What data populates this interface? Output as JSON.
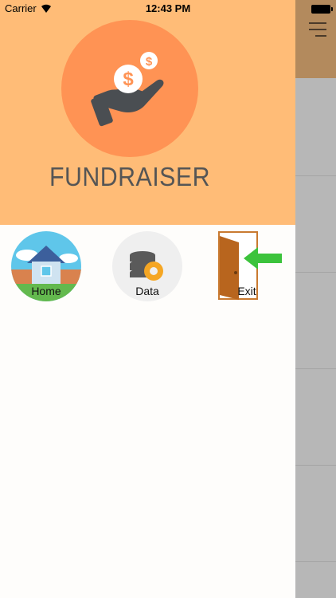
{
  "status_bar": {
    "carrier": "Carrier",
    "time": "12:43 PM"
  },
  "app": {
    "name": "FUNDRAISER",
    "logo_icon": "dollar-hand-icon",
    "accent": "#ffbc77",
    "logo_bg": "#ff9354"
  },
  "menu": [
    {
      "label": "Home",
      "icon": "house-icon"
    },
    {
      "label": "Data",
      "icon": "database-gear-icon"
    },
    {
      "label": "Exit",
      "icon": "door-exit-icon"
    }
  ],
  "background_screen": {
    "header_color": "#b38a5d",
    "body_color": "#b7b7b7",
    "menu_icon": "hamburger-icon"
  }
}
